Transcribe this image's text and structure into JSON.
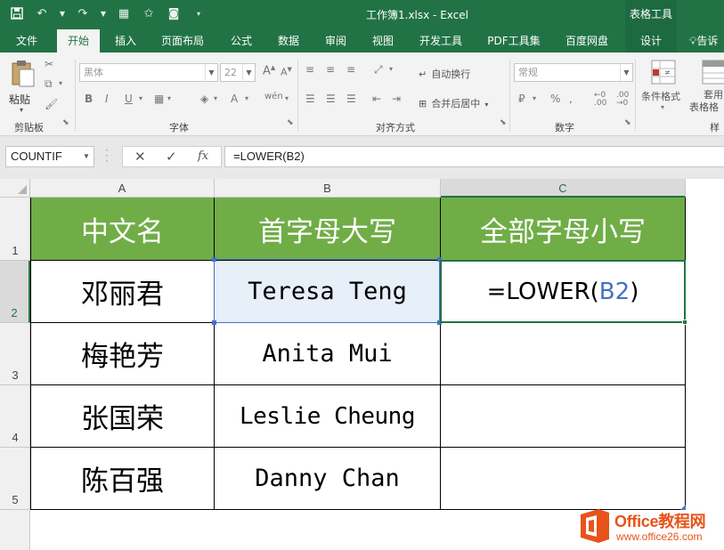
{
  "window": {
    "title": "工作簿1.xlsx - Excel",
    "context_tab_group": "表格工具"
  },
  "tabs": [
    "文件",
    "开始",
    "插入",
    "页面布局",
    "公式",
    "数据",
    "审阅",
    "视图",
    "开发工具",
    "PDF工具集",
    "百度网盘",
    "设计"
  ],
  "tell_me": "告诉",
  "ribbon": {
    "clipboard": {
      "paste_label": "粘贴",
      "group_label": "剪贴板"
    },
    "font": {
      "font_name": "黑体",
      "font_size": "22",
      "group_label": "字体"
    },
    "alignment": {
      "wrap_text": "自动换行",
      "merge_center": "合并后居中",
      "group_label": "对齐方式"
    },
    "number": {
      "format": "常规",
      "group_label": "数字"
    },
    "styles": {
      "conditional_format": "条件格式",
      "table_format_1": "套用",
      "table_format_2": "表格格",
      "group_label": "样"
    }
  },
  "formula_bar": {
    "name_box": "COUNTIF",
    "fx": "fx",
    "content": "=LOWER(B2)"
  },
  "grid": {
    "columns": [
      "A",
      "B",
      "C"
    ],
    "rows": [
      "1",
      "2",
      "3",
      "4",
      "5"
    ],
    "headers": [
      "中文名",
      "首字母大写",
      "全部字母小写"
    ],
    "data": [
      {
        "a": "邓丽君",
        "b": "Teresa Teng"
      },
      {
        "a": "梅艳芳",
        "b": "Anita Mui"
      },
      {
        "a": "张国荣",
        "b": "Leslie Cheung"
      },
      {
        "a": "陈百强",
        "b": "Danny Chan"
      }
    ],
    "c2_formula_prefix": "=LOWER(",
    "c2_formula_ref": "B2",
    "c2_formula_suffix": ")"
  },
  "watermark": {
    "brand": "Office教程网",
    "url": "www.office26.com"
  },
  "colors": {
    "excel_green": "#217346",
    "header_fill": "#70ad47",
    "ref_blue": "#4472c4",
    "watermark": "#e8531a"
  }
}
